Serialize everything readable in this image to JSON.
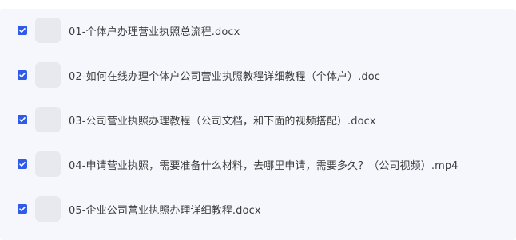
{
  "files": [
    {
      "checked": true,
      "name": "01-个体户办理营业执照总流程.docx"
    },
    {
      "checked": true,
      "name": "02-如何在线办理个体户公司营业执照教程详细教程（个体户）.doc"
    },
    {
      "checked": true,
      "name": "03-公司营业执照办理教程（公司文档，和下面的视频搭配）.docx"
    },
    {
      "checked": true,
      "name": "04-申请营业执照，需要准备什么材料，去哪里申请，需要多久？（公司视频）.mp4"
    },
    {
      "checked": true,
      "name": "05-企业公司营业执照办理详细教程.docx"
    }
  ],
  "colors": {
    "checkbox": "#2f5bea",
    "panel_background": "#f6f7fc",
    "thumbnail": "#e8e9ee",
    "text": "#3d3d3d"
  },
  "icons": {
    "checkmark": "checkmark-icon"
  }
}
